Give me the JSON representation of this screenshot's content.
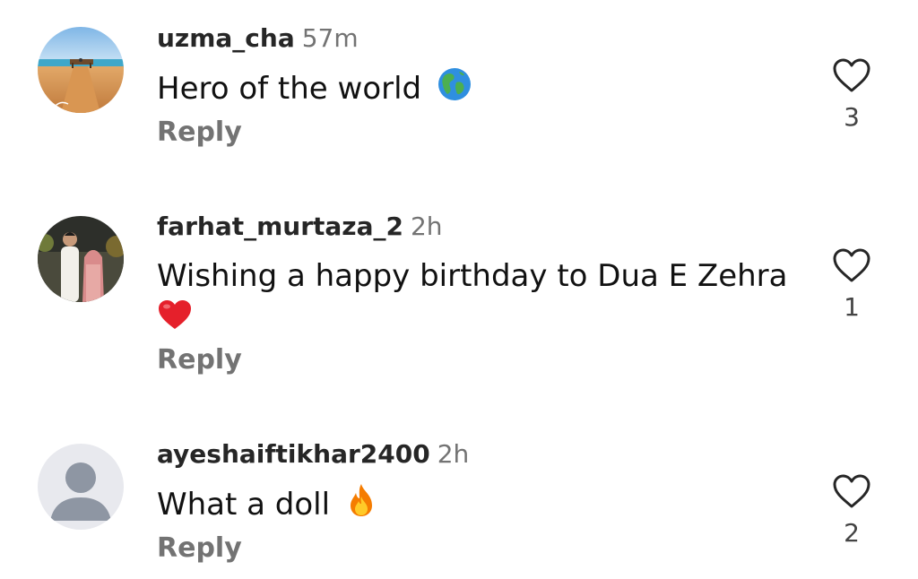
{
  "comments": [
    {
      "avatar_icon": "beach-pier-avatar",
      "username": "uzma_cha",
      "time": "57m",
      "text": "Hero of the world",
      "emoji_icon": "globe-americas-icon",
      "reply_label": "Reply",
      "like_count": "3"
    },
    {
      "avatar_icon": "family-photo-avatar",
      "username": "farhat_murtaza_2",
      "time": "2h",
      "text": "Wishing a happy birthday to Dua E Zehra",
      "emoji_icon": "red-heart-icon",
      "reply_label": "Reply",
      "like_count": "1"
    },
    {
      "avatar_icon": "default-user-avatar",
      "username": "ayeshaiftikhar2400",
      "time": "2h",
      "text": "What a doll",
      "emoji_icon": "fire-icon",
      "reply_label": "Reply",
      "like_count": "2"
    }
  ],
  "colors": {
    "secondary_text": "#737373",
    "heart_outline": "#262626"
  }
}
